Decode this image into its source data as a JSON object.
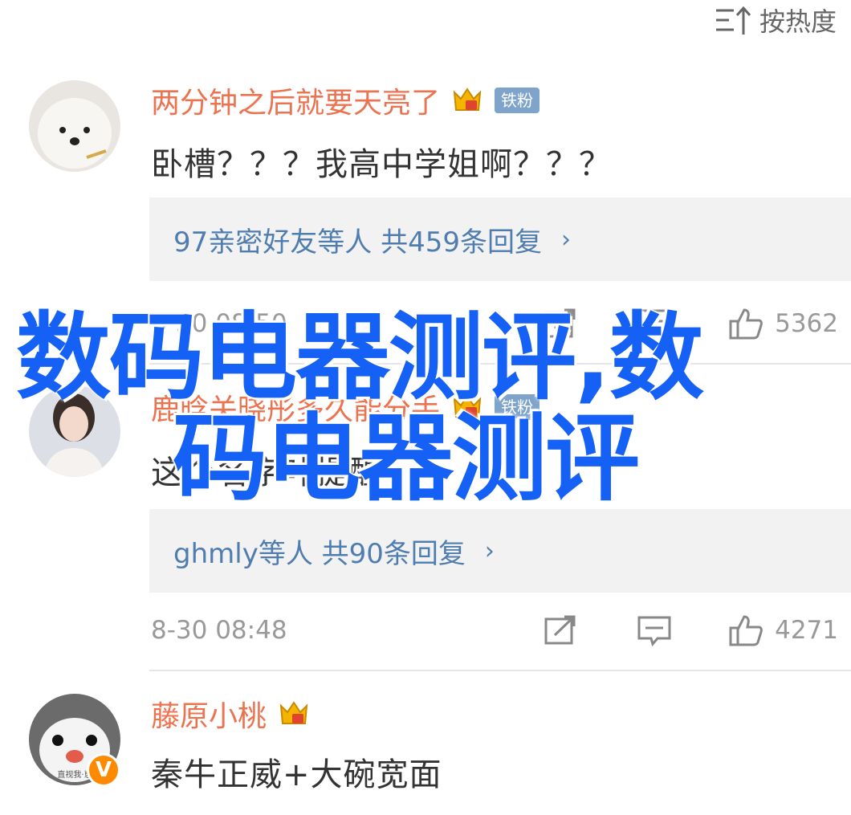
{
  "sort": {
    "label": "按热度"
  },
  "comments": [
    {
      "username": "两分钟之后就要天亮了",
      "fan_badge": "铁粉",
      "text": "卧槽？？？我高中学姐啊？？？",
      "reply_summary": "97亲密好友等人 共459条回复",
      "reply_chevron": "›",
      "timestamp": "8-30 08:50",
      "likes": "5362"
    },
    {
      "username": "鹿晗关晓彤多久能分手",
      "fan_badge": "铁粉",
      "text": "这个名字叶提醒",
      "reply_summary": "ghmly等人 共90条回复",
      "reply_chevron": "›",
      "timestamp": "8-30 08:48",
      "likes": "4271"
    },
    {
      "username": "藤原小桃",
      "text": "秦牛正威+大碗宽面",
      "avatar_caption": "直视我·崽",
      "verified_mark": "V"
    }
  ],
  "overlay": {
    "line1": "数码电器测评,数",
    "line2": "码电器测评"
  },
  "colors": {
    "username": "#eb7350",
    "reply_link": "#507daf",
    "overlay": "#1560f5",
    "fan_badge": "#7fa4cc"
  }
}
